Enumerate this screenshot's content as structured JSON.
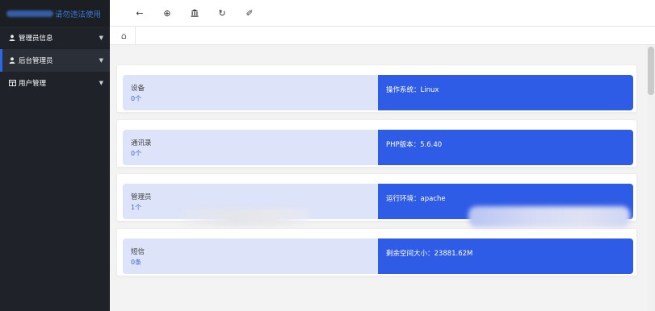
{
  "sidebar": {
    "logo_text": "请勿违法使用",
    "items": [
      {
        "icon": "user-icon",
        "label": "管理员信息",
        "active": false
      },
      {
        "icon": "user-icon",
        "label": "后台管理员",
        "active": true
      },
      {
        "icon": "table-icon",
        "label": "用户管理",
        "active": false
      }
    ]
  },
  "toolbar": {
    "buttons": [
      {
        "icon": "arrow-left-icon",
        "glyph": "←"
      },
      {
        "icon": "target-icon",
        "glyph": "⊕"
      },
      {
        "icon": "bank-icon",
        "glyph": "🏛"
      },
      {
        "icon": "refresh-icon",
        "glyph": "↻"
      },
      {
        "icon": "broom-icon",
        "glyph": "✐"
      }
    ]
  },
  "tabs": {
    "home_icon": "home-icon",
    "home_glyph": "⌂"
  },
  "stats": [
    {
      "title": "设备",
      "count": "0个",
      "info": "操作系统：Linux"
    },
    {
      "title": "通讯录",
      "count": "0个",
      "info": "PHP版本：5.6.40"
    },
    {
      "title": "管理员",
      "count": "1个",
      "info": "运行环境：apache"
    },
    {
      "title": "短信",
      "count": "0条",
      "info": "剩余空间大小：23881.62M"
    }
  ],
  "colors": {
    "sidebar_bg": "#1f2329",
    "accent_blue": "#2f5ce6",
    "card_left_bg": "#dde3f8"
  }
}
